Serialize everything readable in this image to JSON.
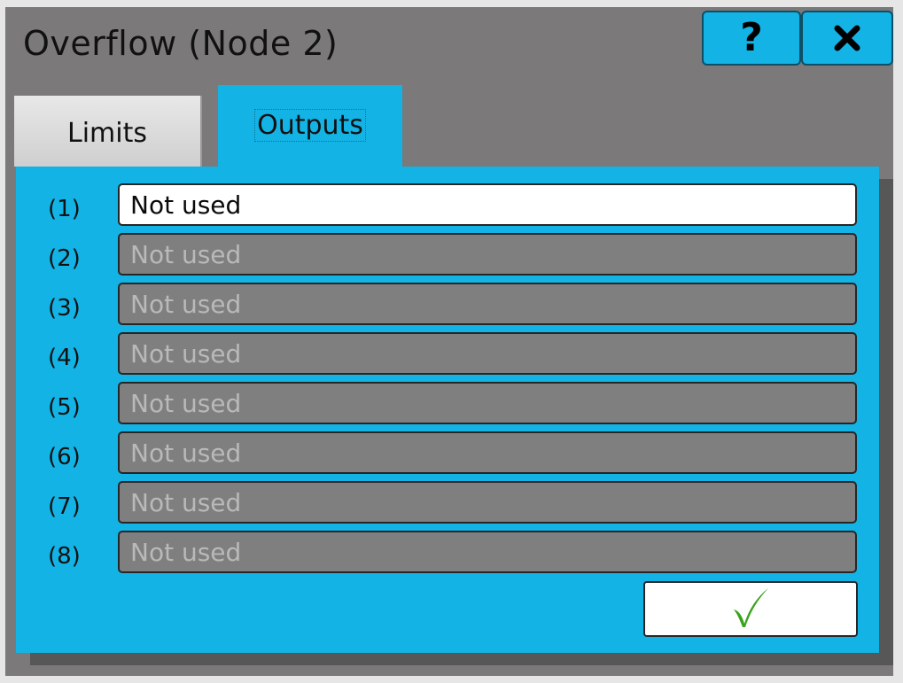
{
  "dialog": {
    "title": "Overflow (Node 2)",
    "help_label": "?",
    "close_icon": "close-icon"
  },
  "tabs": [
    {
      "label": "Limits",
      "active": false
    },
    {
      "label": "Outputs",
      "active": true
    }
  ],
  "outputs": [
    {
      "index": "(1)",
      "value": "Not used",
      "enabled": true
    },
    {
      "index": "(2)",
      "value": "Not used",
      "enabled": false
    },
    {
      "index": "(3)",
      "value": "Not used",
      "enabled": false
    },
    {
      "index": "(4)",
      "value": "Not used",
      "enabled": false
    },
    {
      "index": "(5)",
      "value": "Not used",
      "enabled": false
    },
    {
      "index": "(6)",
      "value": "Not used",
      "enabled": false
    },
    {
      "index": "(7)",
      "value": "Not used",
      "enabled": false
    },
    {
      "index": "(8)",
      "value": "Not used",
      "enabled": false
    }
  ],
  "confirm": {
    "icon": "checkmark-icon",
    "color": "#3aa31c"
  },
  "colors": {
    "accent": "#13b3e5",
    "window_bg": "#7b7979",
    "disabled_field": "#807f80"
  }
}
